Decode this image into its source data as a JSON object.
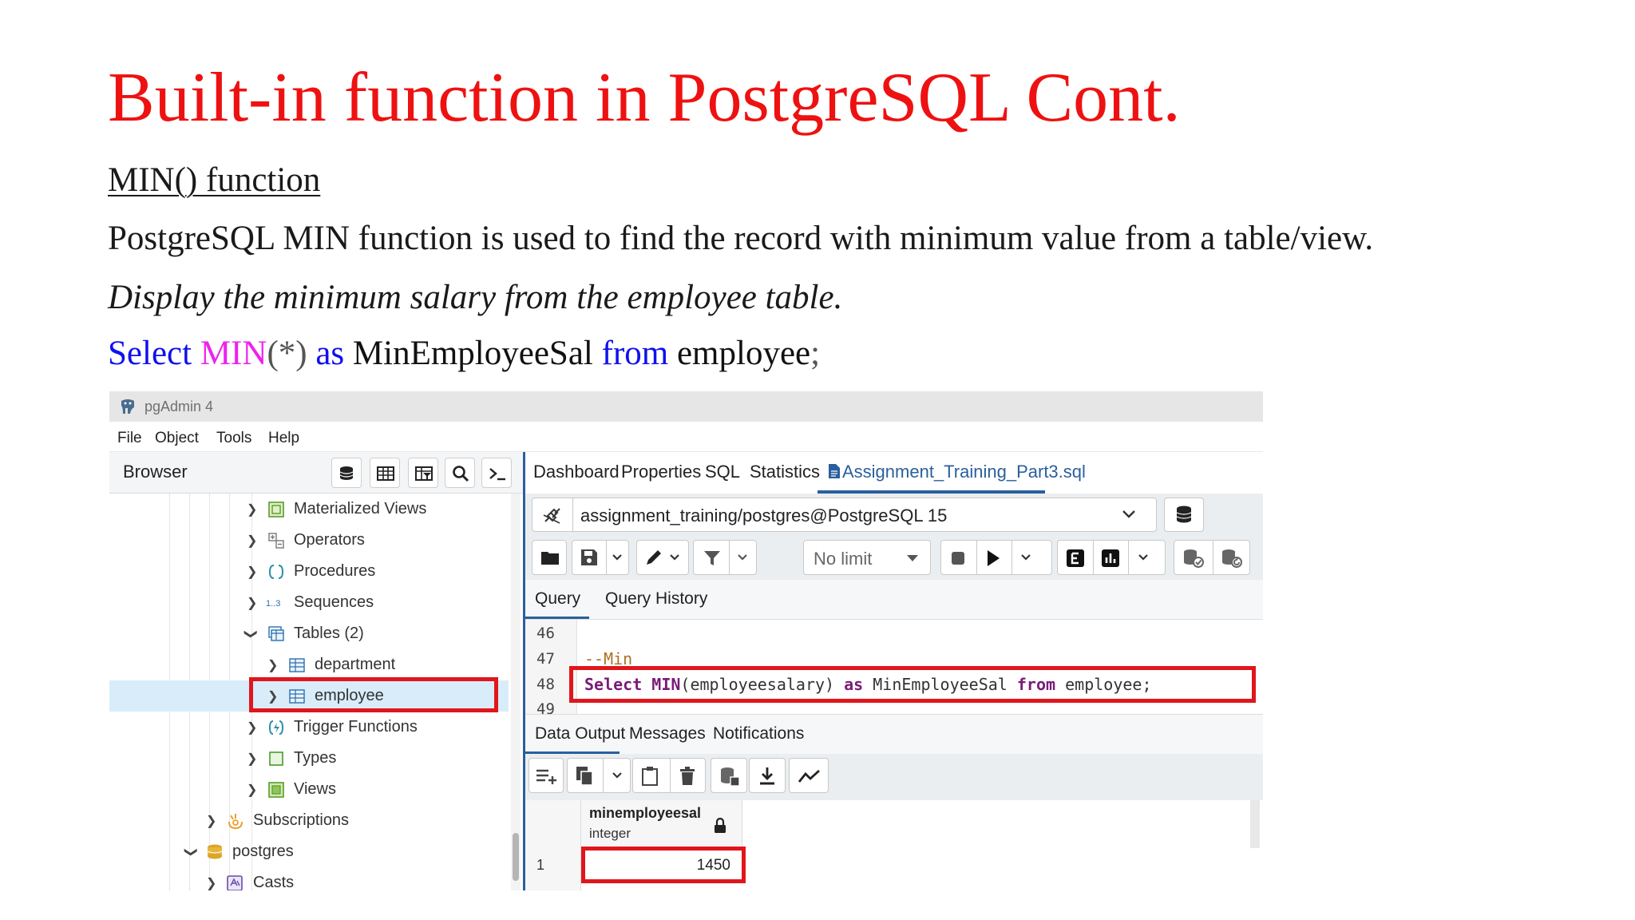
{
  "slide": {
    "title": "Built-in function in PostgreSQL Cont.",
    "subheading": "MIN() function",
    "description": "PostgreSQL MIN function is used to find the record with minimum value from a table/view.",
    "task": "Display the minimum salary from the employee table.",
    "query": {
      "select": "Select",
      "min": "MIN",
      "args": "(*)",
      "as": "as",
      "alias": "MinEmployeeSal",
      "from": "from",
      "table": "employee",
      "semicolon": ";"
    }
  },
  "pgadmin": {
    "app_title": "pgAdmin 4",
    "menu": [
      "File",
      "Object",
      "Tools",
      "Help"
    ],
    "browser_label": "Browser",
    "tree": [
      {
        "label": "Materialized Views",
        "icon": "materialized-view-icon",
        "expanded": false
      },
      {
        "label": "Operators",
        "icon": "operator-icon",
        "expanded": false
      },
      {
        "label": "Procedures",
        "icon": "procedure-icon",
        "expanded": false
      },
      {
        "label": "Sequences",
        "icon": "sequence-icon",
        "expanded": false
      },
      {
        "label": "Tables (2)",
        "icon": "tables-icon",
        "expanded": true
      },
      {
        "label": "department",
        "icon": "table-icon",
        "expanded": false
      },
      {
        "label": "employee",
        "icon": "table-icon",
        "expanded": false,
        "selected": true
      },
      {
        "label": "Trigger Functions",
        "icon": "trigger-function-icon",
        "expanded": false
      },
      {
        "label": "Types",
        "icon": "type-icon",
        "expanded": false
      },
      {
        "label": "Views",
        "icon": "view-icon",
        "expanded": false
      },
      {
        "label": "Subscriptions",
        "icon": "subscription-icon",
        "expanded": false
      },
      {
        "label": "postgres",
        "icon": "database-icon",
        "expanded": true
      },
      {
        "label": "Casts",
        "icon": "cast-icon",
        "expanded": false
      }
    ],
    "tabs": [
      "Dashboard",
      "Properties",
      "SQL",
      "Statistics",
      "Assignment_Training_Part3.sql"
    ],
    "active_tab": "Assignment_Training_Part3.sql",
    "connection": "assignment_training/postgres@PostgreSQL 15",
    "row_limit": "No limit",
    "query_tabs": [
      "Query",
      "Query History"
    ],
    "editor": {
      "lines": [
        {
          "num": "46",
          "text": ""
        },
        {
          "num": "47",
          "comment": "--Min"
        },
        {
          "num": "48",
          "kw_select": "Select",
          "kw_min": "MIN",
          "args": "(employeesalary)",
          "kw_as": "as",
          "alias": "MinEmployeeSal",
          "kw_from": "from",
          "rest": "employee;"
        },
        {
          "num": "49",
          "text": ""
        }
      ]
    },
    "output_tabs": [
      "Data Output",
      "Messages",
      "Notifications"
    ],
    "result": {
      "column_name": "minemployeesal",
      "column_type": "integer",
      "row_number": "1",
      "value": "1450"
    },
    "colors": {
      "accent": "#2a5f9e",
      "highlight": "#e0161c",
      "title_red": "#ee1111"
    }
  }
}
